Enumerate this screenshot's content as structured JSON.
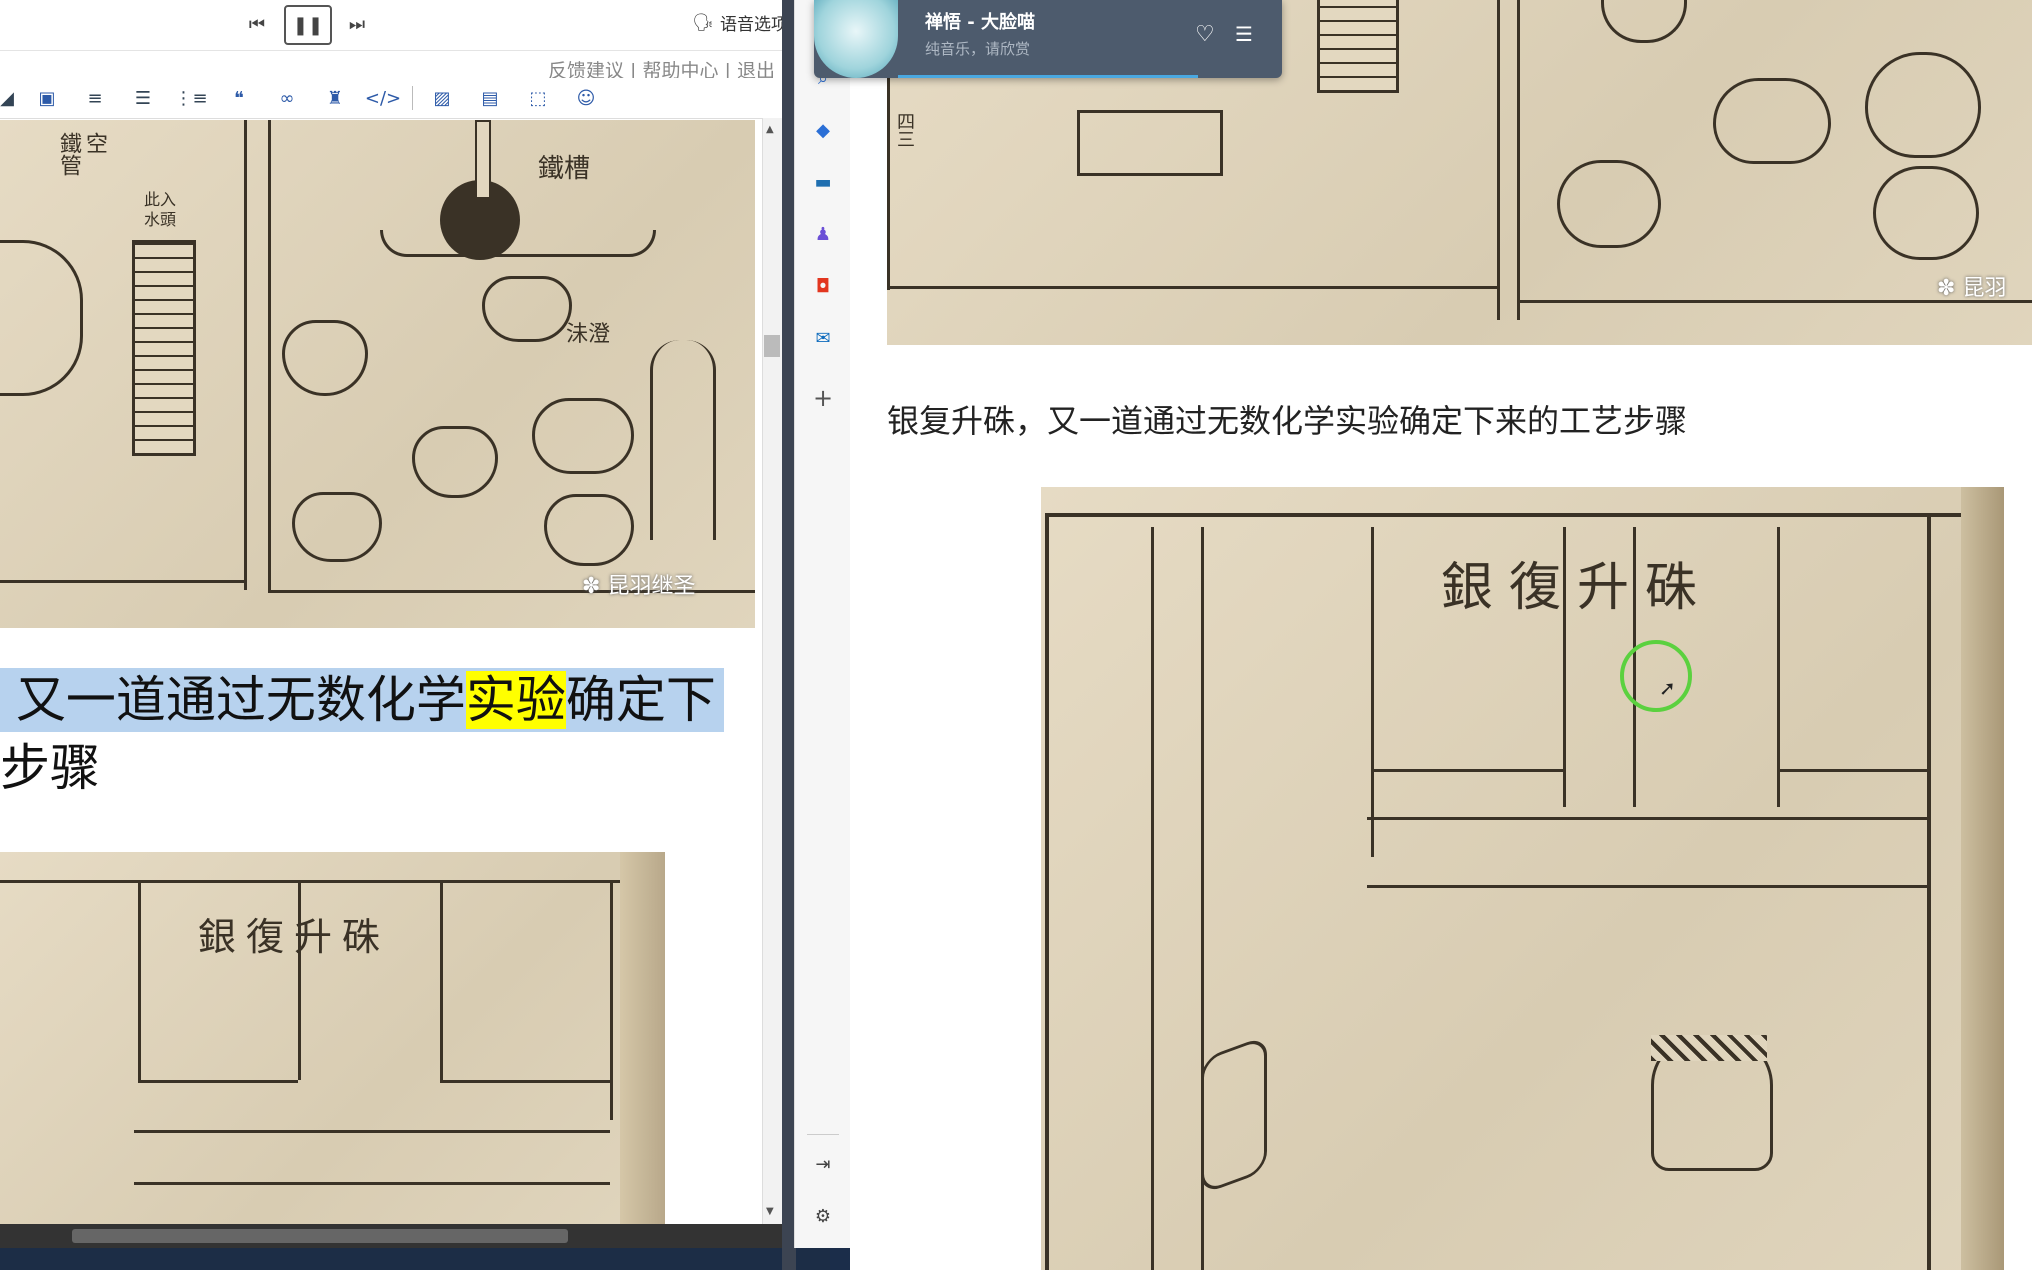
{
  "media_bar": {
    "voice_options_label": "语音选项",
    "links_text": "反馈建议 | 帮助中心 | 退出"
  },
  "editor": {
    "img1_caption": "昆羽继圣",
    "img1_labels": [
      "鐵管",
      "空",
      "鐵槽",
      "此入水頭",
      "沬澄"
    ],
    "line1_before": "又一道通过无数化学",
    "line1_highlight": "实验",
    "line1_after": "确定下",
    "line2": "步骤",
    "img2_title": "銀復升硃"
  },
  "sidebar": {
    "icons": [
      "search-icon",
      "tag-icon",
      "toolbox-icon",
      "people-icon",
      "office-icon",
      "outlook-icon",
      "add-icon",
      "exit-panel-icon",
      "settings-icon"
    ]
  },
  "article": {
    "img1_caption": "昆羽",
    "img1_label": "四三",
    "caption": "银复升硃，又一道通过无数化学实验确定下来的工艺步骤",
    "img2_title": "銀復升硃"
  },
  "music_player": {
    "title": "禅悟 - 大脸喵",
    "subtitle": "纯音乐，请欣赏",
    "progress": 0.78
  },
  "colors": {
    "selection": "#b7d2ee",
    "highlight": "#ffff00",
    "cursor_ring": "#5bd13f",
    "player_bg": "#4d5b6d"
  }
}
